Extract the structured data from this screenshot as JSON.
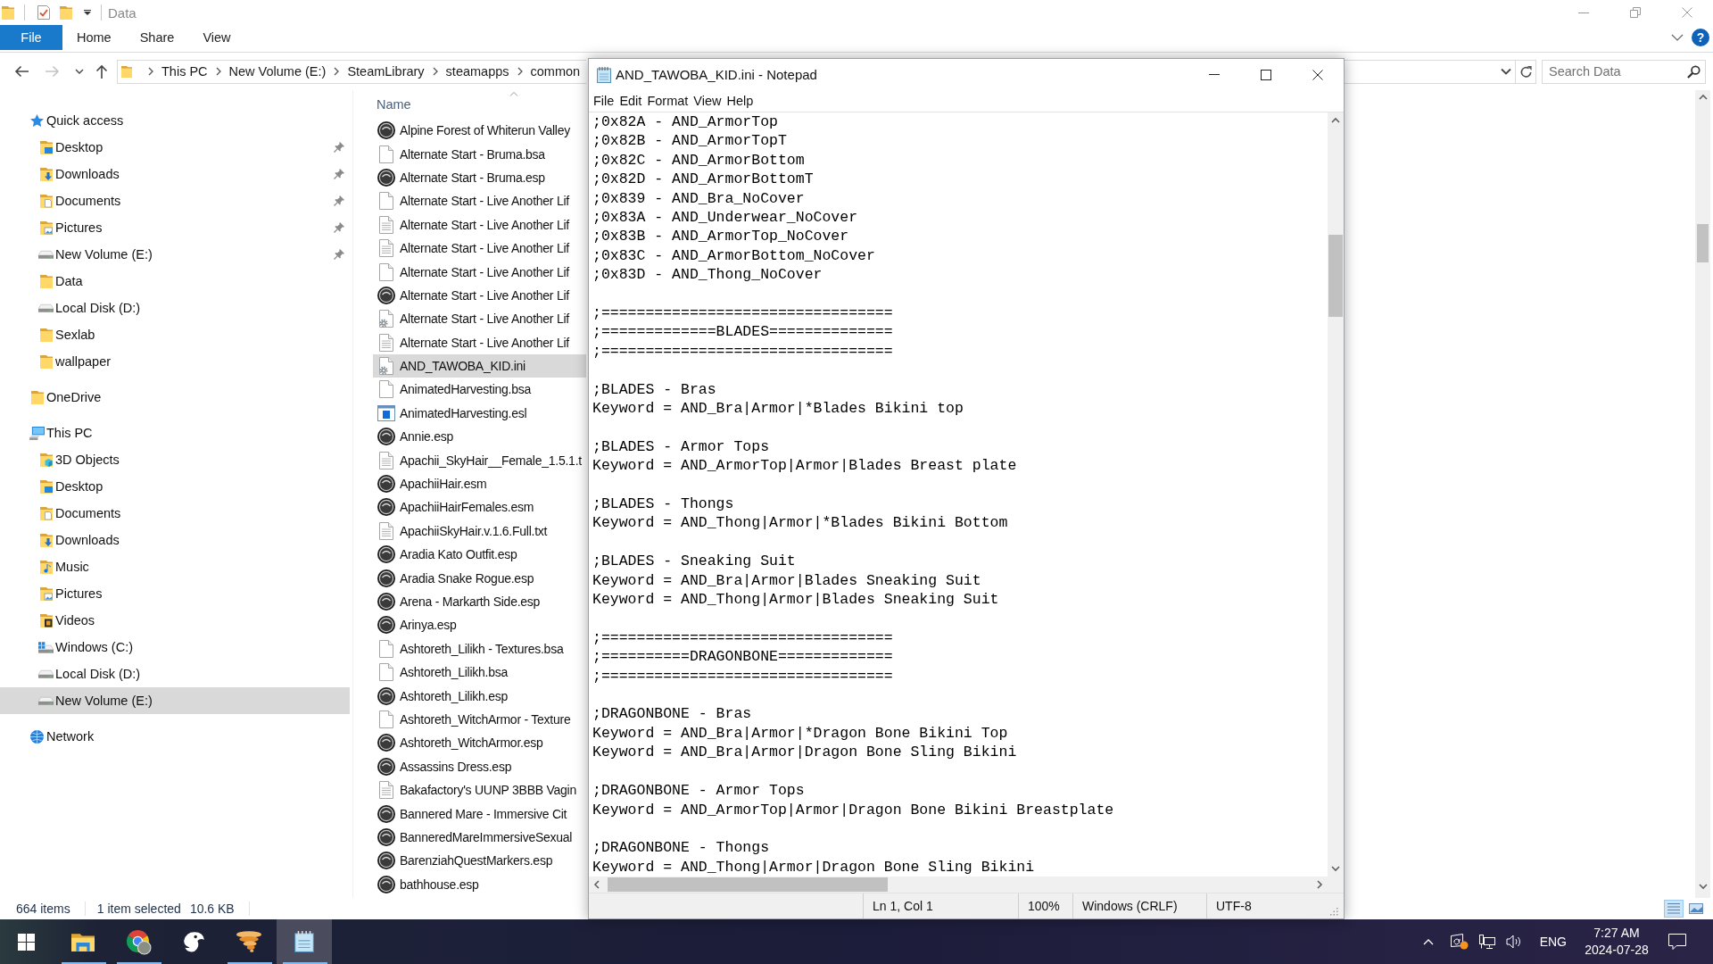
{
  "explorer": {
    "title": "Data",
    "ribbon": {
      "tabs": [
        {
          "label": "File",
          "kind": "menu"
        },
        {
          "label": "Home",
          "kind": "tab"
        },
        {
          "label": "Share",
          "kind": "tab"
        },
        {
          "label": "View",
          "kind": "tab"
        }
      ],
      "help": "?"
    },
    "nav_buttons": [
      {
        "kind": "back",
        "disabled": false
      },
      {
        "kind": "forward",
        "disabled": true
      },
      {
        "kind": "recent",
        "disabled": false
      },
      {
        "kind": "up",
        "disabled": false
      }
    ],
    "address": {
      "path": [
        "This PC",
        "New Volume (E:)",
        "SteamLibrary",
        "steamapps",
        "common"
      ]
    },
    "search": {
      "placeholder": "Search Data"
    },
    "nav_pane": [
      {
        "label": "Quick access",
        "kind": "star",
        "selected": false,
        "children": [
          {
            "label": "Desktop",
            "kind": "desktop",
            "pinned": true,
            "selected": false
          },
          {
            "label": "Downloads",
            "kind": "downloads",
            "pinned": true,
            "selected": false
          },
          {
            "label": "Documents",
            "kind": "documents",
            "pinned": true,
            "selected": false
          },
          {
            "label": "Pictures",
            "kind": "pictures",
            "pinned": true,
            "selected": false
          },
          {
            "label": "New Volume (E:)",
            "kind": "drive",
            "pinned": true,
            "selected": false
          },
          {
            "label": "Data",
            "kind": "folder",
            "pinned": false,
            "selected": false
          },
          {
            "label": "Local Disk (D:)",
            "kind": "drive",
            "pinned": false,
            "selected": false
          },
          {
            "label": "Sexlab",
            "kind": "folder",
            "pinned": false,
            "selected": false
          },
          {
            "label": "wallpaper",
            "kind": "folder",
            "pinned": false,
            "selected": false
          }
        ]
      },
      {
        "label": "OneDrive",
        "kind": "folder",
        "selected": false
      },
      {
        "label": "This PC",
        "kind": "pc",
        "selected": false,
        "children": [
          {
            "label": "3D Objects",
            "kind": "objects",
            "selected": false
          },
          {
            "label": "Desktop",
            "kind": "desktop",
            "selected": false
          },
          {
            "label": "Documents",
            "kind": "documents",
            "selected": false
          },
          {
            "label": "Downloads",
            "kind": "downloads",
            "selected": false
          },
          {
            "label": "Music",
            "kind": "music",
            "selected": false
          },
          {
            "label": "Pictures",
            "kind": "pictures",
            "selected": false
          },
          {
            "label": "Videos",
            "kind": "videos",
            "selected": false
          },
          {
            "label": "Windows (C:)",
            "kind": "system",
            "selected": false
          },
          {
            "label": "Local Disk (D:)",
            "kind": "drive",
            "selected": false
          },
          {
            "label": "New Volume (E:)",
            "kind": "drive",
            "selected": true
          }
        ]
      },
      {
        "label": "Network",
        "kind": "network",
        "selected": false
      }
    ],
    "file_list": {
      "column": "Name",
      "files": [
        {
          "name": "Alpine Forest of Whiterun Valley",
          "kind": "disc",
          "selected": false
        },
        {
          "name": "Alternate Start - Bruma.bsa",
          "kind": "blank",
          "selected": false
        },
        {
          "name": "Alternate Start - Bruma.esp",
          "kind": "disc",
          "selected": false
        },
        {
          "name": "Alternate Start - Live Another Lif",
          "kind": "blank",
          "selected": false
        },
        {
          "name": "Alternate Start - Live Another Lif",
          "kind": "text",
          "selected": false
        },
        {
          "name": "Alternate Start - Live Another Lif",
          "kind": "text",
          "selected": false
        },
        {
          "name": "Alternate Start - Live Another Lif",
          "kind": "blank",
          "selected": false
        },
        {
          "name": "Alternate Start - Live Another Lif",
          "kind": "disc",
          "selected": false
        },
        {
          "name": "Alternate Start - Live Another Lif",
          "kind": "config",
          "selected": false
        },
        {
          "name": "Alternate Start - Live Another Lif",
          "kind": "text",
          "selected": false
        },
        {
          "name": "AND_TAWOBA_KID.ini",
          "kind": "config",
          "selected": true
        },
        {
          "name": "AnimatedHarvesting.bsa",
          "kind": "blank",
          "selected": false
        },
        {
          "name": "AnimatedHarvesting.esl",
          "kind": "app",
          "selected": false
        },
        {
          "name": "Annie.esp",
          "kind": "disc",
          "selected": false
        },
        {
          "name": "Apachii_SkyHair__Female_1.5.1.t",
          "kind": "text",
          "selected": false
        },
        {
          "name": "ApachiiHair.esm",
          "kind": "disc",
          "selected": false
        },
        {
          "name": "ApachiiHairFemales.esm",
          "kind": "disc",
          "selected": false
        },
        {
          "name": "ApachiiSkyHair.v.1.6.Full.txt",
          "kind": "text",
          "selected": false
        },
        {
          "name": "Aradia Kato Outfit.esp",
          "kind": "disc",
          "selected": false
        },
        {
          "name": "Aradia Snake Rogue.esp",
          "kind": "disc",
          "selected": false
        },
        {
          "name": "Arena - Markarth Side.esp",
          "kind": "disc",
          "selected": false
        },
        {
          "name": "Arinya.esp",
          "kind": "disc",
          "selected": false
        },
        {
          "name": "Ashtoreth_Lilikh - Textures.bsa",
          "kind": "blank",
          "selected": false
        },
        {
          "name": "Ashtoreth_Lilikh.bsa",
          "kind": "blank",
          "selected": false
        },
        {
          "name": "Ashtoreth_Lilikh.esp",
          "kind": "disc",
          "selected": false
        },
        {
          "name": "Ashtoreth_WitchArmor - Texture",
          "kind": "blank",
          "selected": false
        },
        {
          "name": "Ashtoreth_WitchArmor.esp",
          "kind": "disc",
          "selected": false
        },
        {
          "name": "Assassins Dress.esp",
          "kind": "disc",
          "selected": false
        },
        {
          "name": "Bakafactory's UUNP 3BBB Vagin",
          "kind": "text",
          "selected": false
        },
        {
          "name": "Bannered Mare - Immersive Cit",
          "kind": "disc",
          "selected": false
        },
        {
          "name": "BanneredMareImmersiveSexual",
          "kind": "disc",
          "selected": false
        },
        {
          "name": "BarenziahQuestMarkers.esp",
          "kind": "disc",
          "selected": false
        },
        {
          "name": "bathhouse.esp",
          "kind": "disc",
          "selected": false
        }
      ]
    },
    "status_bar": {
      "count": "664 items",
      "selection": "1 item selected",
      "size": "10.6 KB"
    },
    "views": [
      {
        "kind": "details",
        "selected": true
      },
      {
        "kind": "tiles",
        "selected": false
      }
    ]
  },
  "notepad": {
    "title": "AND_TAWOBA_KID.ini - Notepad",
    "menu": [
      "File",
      "Edit",
      "Format",
      "View",
      "Help"
    ],
    "blocks": [
      [
        ";0x82A - AND_ArmorTop",
        ";0x82B - AND_ArmorTopT",
        ";0x82C - AND_ArmorBottom",
        ";0x82D - AND_ArmorBottomT",
        ";0x839 - AND_Bra_NoCover",
        ";0x83A - AND_Underwear_NoCover",
        ";0x83B - AND_ArmorTop_NoCover",
        ";0x83C - AND_ArmorBottom_NoCover",
        ";0x83D - AND_Thong_NoCover"
      ],
      [
        ";=================================",
        ";=============BLADES==============",
        ";================================="
      ],
      [
        ";BLADES - Bras",
        "Keyword = AND_Bra|Armor|*Blades Bikini top"
      ],
      [
        ";BLADES - Armor Tops",
        "Keyword = AND_ArmorTop|Armor|Blades Breast plate"
      ],
      [
        ";BLADES - Thongs",
        "Keyword = AND_Thong|Armor|*Blades Bikini Bottom"
      ],
      [
        ";BLADES - Sneaking Suit",
        "Keyword = AND_Bra|Armor|Blades Sneaking Suit",
        "Keyword = AND_Thong|Armor|Blades Sneaking Suit"
      ],
      [
        ";=================================",
        ";==========DRAGONBONE=============",
        ";================================="
      ],
      [
        ";DRAGONBONE - Bras",
        "Keyword = AND_Bra|Armor|*Dragon Bone Bikini Top",
        "Keyword = AND_Bra|Armor|Dragon Bone Sling Bikini"
      ],
      [
        ";DRAGONBONE - Armor Tops",
        "Keyword = AND_ArmorTop|Armor|Dragon Bone Bikini Breastplate"
      ],
      [
        ";DRAGONBONE - Thongs",
        "Keyword = AND_Thong|Armor|Dragon Bone Sling Bikini"
      ]
    ],
    "status": {
      "position": "Ln 1, Col 1",
      "zoom": "100%",
      "line_ending": "Windows (CRLF)",
      "encoding": "UTF-8"
    }
  },
  "taskbar": {
    "apps": [
      {
        "kind": "explorer",
        "running": true,
        "active": false
      },
      {
        "kind": "browser",
        "running": true,
        "active": false
      },
      {
        "kind": "bird",
        "running": false,
        "active": false
      },
      {
        "kind": "tornado",
        "running": true,
        "active": false
      },
      {
        "kind": "notepad",
        "running": true,
        "active": true
      }
    ],
    "language": "ENG",
    "time": "7:27 AM",
    "date": "2024-07-28"
  }
}
